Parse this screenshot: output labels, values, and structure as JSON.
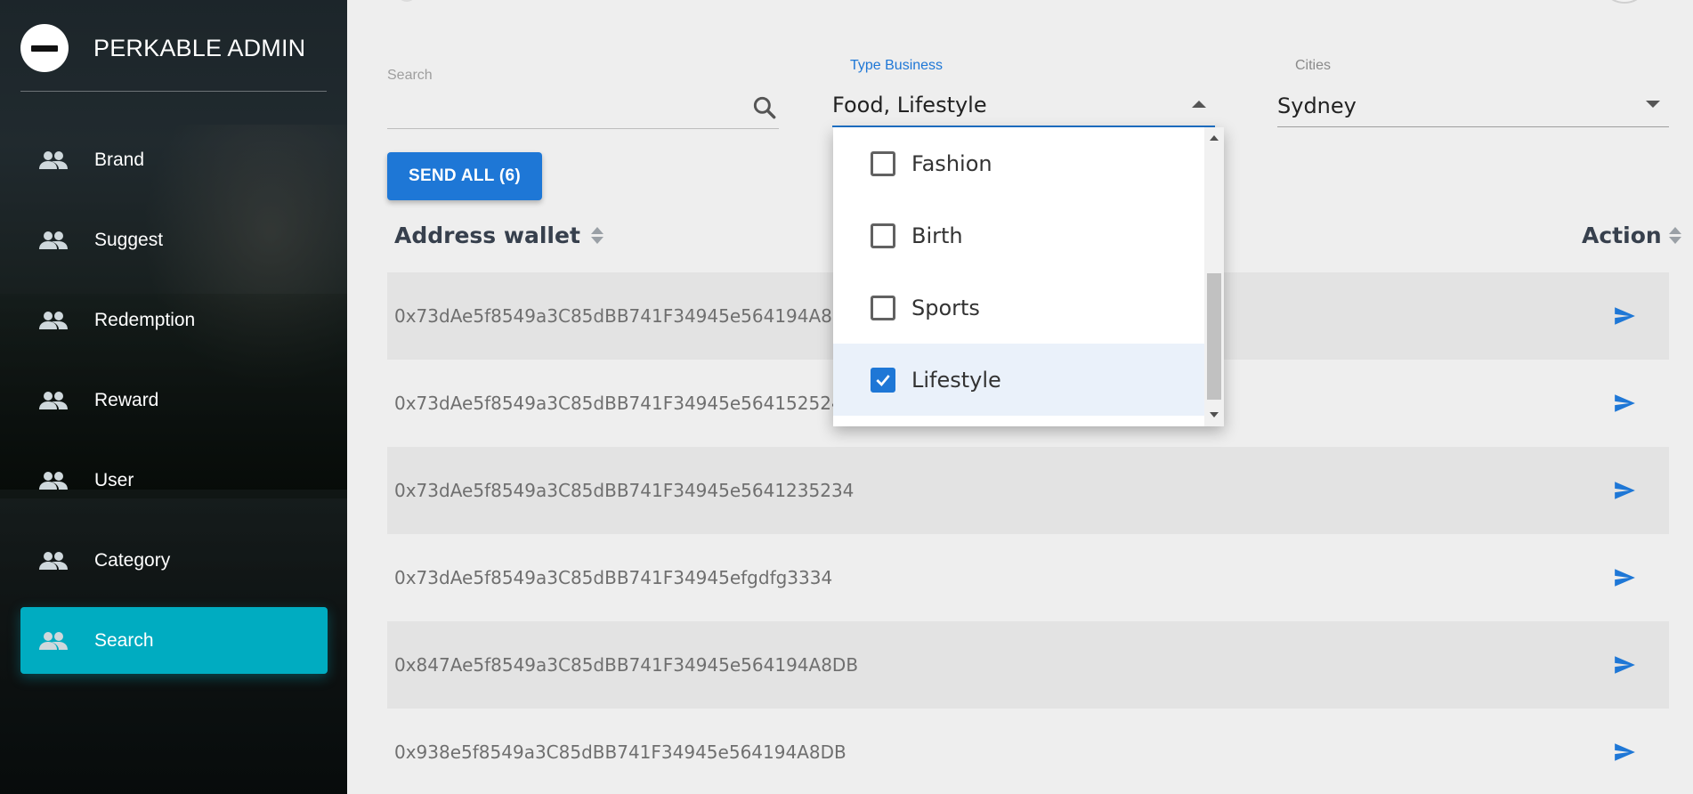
{
  "app": {
    "title": "PERKABLE ADMIN",
    "logo_icon": "perkable-logo-icon"
  },
  "sidebar": {
    "items": [
      {
        "label": "Brand",
        "icon": "people-icon"
      },
      {
        "label": "Suggest",
        "icon": "people-icon"
      },
      {
        "label": "Redemption",
        "icon": "people-icon"
      },
      {
        "label": "Reward",
        "icon": "people-icon"
      },
      {
        "label": "User",
        "icon": "people-icon"
      },
      {
        "label": "Category",
        "icon": "people-icon"
      },
      {
        "label": "Search",
        "icon": "people-icon",
        "active": true
      }
    ]
  },
  "filters": {
    "search": {
      "label": "Search",
      "value": "",
      "icon": "search-icon"
    },
    "type_business": {
      "label": "Type Business",
      "value": "Food, Lifestyle",
      "open": true
    },
    "cities": {
      "label": "Cities",
      "value": "Sydney"
    }
  },
  "dropdown": {
    "options": [
      {
        "label": "Fashion",
        "checked": false
      },
      {
        "label": "Birth",
        "checked": false
      },
      {
        "label": "Sports",
        "checked": false
      },
      {
        "label": "Lifestyle",
        "checked": true
      }
    ]
  },
  "send_all": {
    "label": "SEND ALL (6)"
  },
  "table": {
    "headers": {
      "address": "Address wallet",
      "action": "Action"
    },
    "rows": [
      {
        "address": "0x73dAe5f8549a3C85dBB741F34945e564194A8DBE"
      },
      {
        "address": "0x73dAe5f8549a3C85dBB741F34945e5641525245"
      },
      {
        "address": "0x73dAe5f8549a3C85dBB741F34945e5641235234"
      },
      {
        "address": "0x73dAe5f8549a3C85dBB741F34945efgdfg3334"
      },
      {
        "address": "0x847Ae5f8549a3C85dBB741F34945e564194A8DB"
      },
      {
        "address": "0x938e5f8549a3C85dBB741F34945e564194A8DB"
      }
    ]
  },
  "colors": {
    "accent": "#1e77d6",
    "active_nav": "#00acc1",
    "background": "#eeeeee"
  }
}
